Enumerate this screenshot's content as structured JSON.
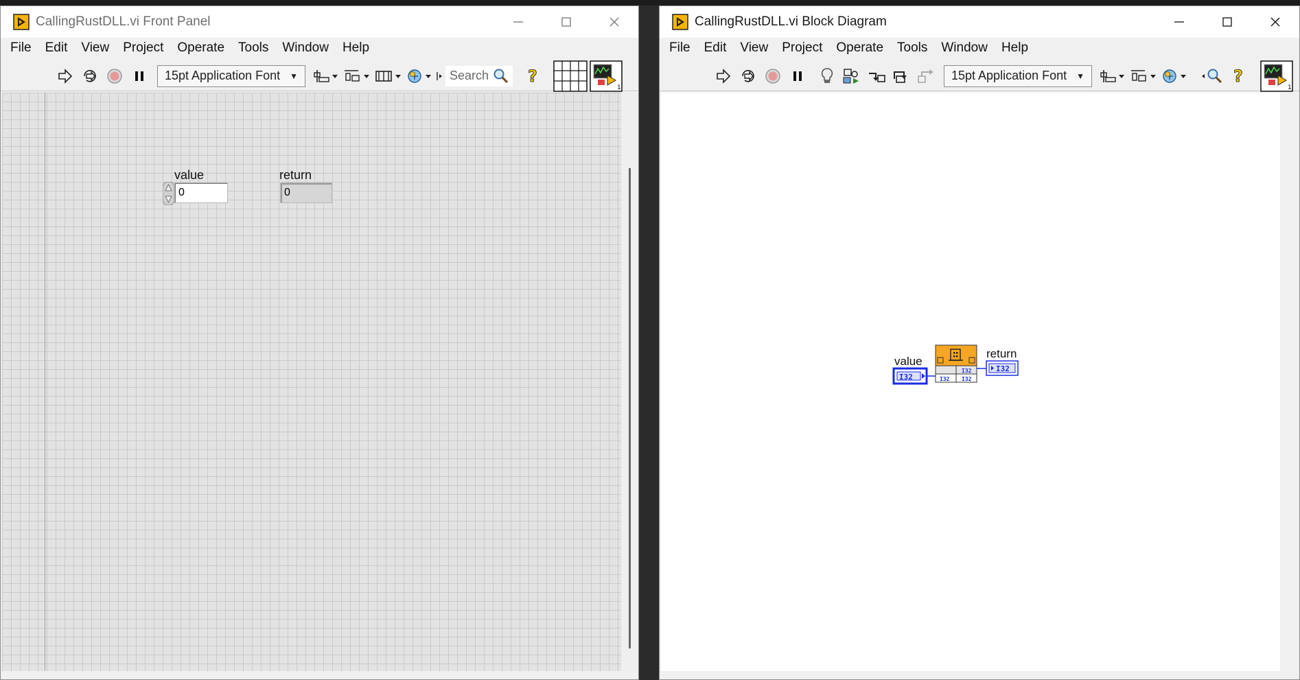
{
  "front_panel": {
    "title": "CallingRustDLL.vi Front Panel",
    "menu": [
      "File",
      "Edit",
      "View",
      "Project",
      "Operate",
      "Tools",
      "Window",
      "Help"
    ],
    "font_select": "15pt Application Font",
    "search_placeholder": "Search",
    "controls": {
      "value_label": "value",
      "value": "0",
      "return_label": "return",
      "return_value": "0"
    }
  },
  "block_diagram": {
    "title": "CallingRustDLL.vi Block Diagram",
    "menu": [
      "File",
      "Edit",
      "View",
      "Project",
      "Operate",
      "Tools",
      "Window",
      "Help"
    ],
    "font_select": "15pt Application Font",
    "nodes": {
      "value_label": "value",
      "value_type": "I32",
      "return_label": "return",
      "return_type": "I32",
      "dll_in_type": "I32",
      "dll_out_type": "I32"
    }
  },
  "colors": {
    "vi_icon": "#f4b400",
    "terminal_blue": "#1a2ee0",
    "clfn_orange": "#f5a623",
    "canvas_grid": "#e3e3e3"
  }
}
